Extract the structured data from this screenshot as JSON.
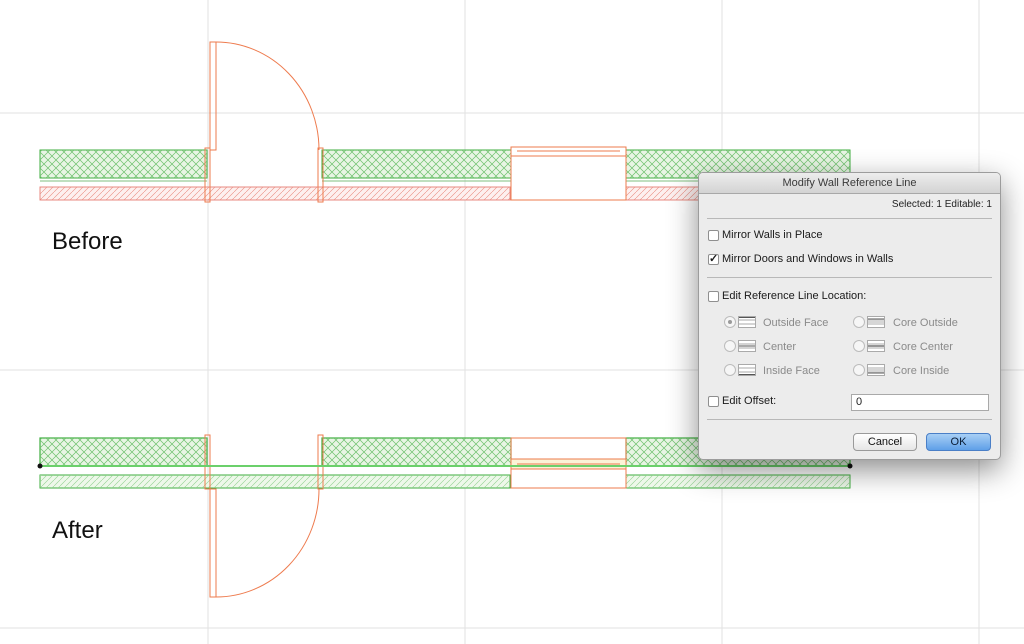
{
  "canvas": {
    "before_label": "Before",
    "after_label": "After",
    "colors": {
      "wall_outline": "#3fae3f",
      "wall_hatch": "#6cc06c",
      "opening": "#ee7b4e",
      "grid": "#e2e2e2",
      "reference_line": "#6bd06b"
    }
  },
  "dialog": {
    "title": "Modify Wall Reference Line",
    "selection_info": "Selected: 1 Editable: 1",
    "mirror_walls_label": "Mirror Walls in Place",
    "mirror_walls_checked": false,
    "mirror_doors_label": "Mirror Doors and Windows in Walls",
    "mirror_doors_checked": true,
    "edit_reference_label": "Edit Reference Line Location:",
    "edit_reference_checked": false,
    "options": {
      "outside_face": "Outside Face",
      "core_outside": "Core Outside",
      "center": "Center",
      "core_center": "Core Center",
      "inside_face": "Inside Face",
      "core_inside": "Core Inside"
    },
    "selected_option": "Outside Face",
    "edit_offset_label": "Edit Offset:",
    "edit_offset_checked": false,
    "offset_value": "0",
    "cancel_label": "Cancel",
    "ok_label": "OK"
  }
}
